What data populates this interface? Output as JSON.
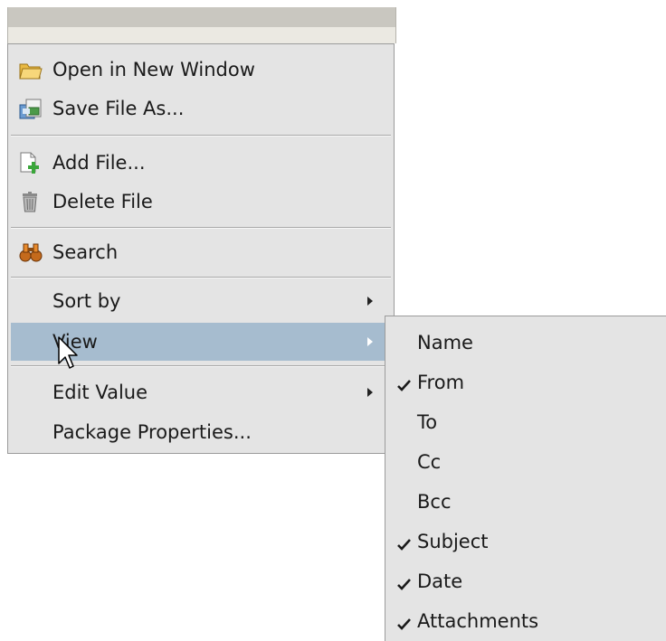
{
  "context_menu": {
    "items": [
      {
        "label": "Open in New Window",
        "icon": "folder-open-icon"
      },
      {
        "label": "Save File As...",
        "icon": "save-file-icon"
      },
      {
        "label": "Add File...",
        "icon": "add-file-icon"
      },
      {
        "label": "Delete File",
        "icon": "trash-icon"
      },
      {
        "label": "Search",
        "icon": "search-binoculars-icon"
      },
      {
        "label": "Sort by",
        "submenu": true
      },
      {
        "label": "View",
        "submenu": true,
        "highlighted": true
      },
      {
        "label": "Edit Value",
        "submenu": true
      },
      {
        "label": "Package Properties..."
      }
    ]
  },
  "view_submenu": {
    "items": [
      {
        "label": "Name",
        "checked": false
      },
      {
        "label": "From",
        "checked": true
      },
      {
        "label": "To",
        "checked": false
      },
      {
        "label": "Cc",
        "checked": false
      },
      {
        "label": "Bcc",
        "checked": false
      },
      {
        "label": "Subject",
        "checked": true
      },
      {
        "label": "Date",
        "checked": true
      },
      {
        "label": "Attachments",
        "checked": true
      }
    ]
  },
  "colors": {
    "menu_background": "#e4e4e4",
    "highlight": "#a6bccf",
    "check_mark": "#1a1a1a"
  }
}
